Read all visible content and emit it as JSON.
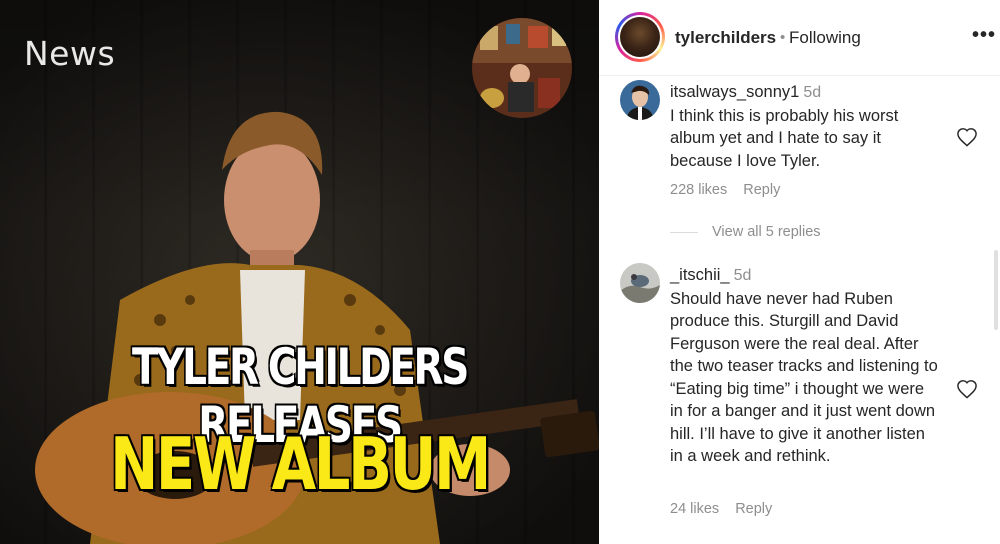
{
  "media": {
    "news_label": "News",
    "headline_line1": "TYLER CHILDERS RELEASES",
    "headline_line2": "NEW ALBUM",
    "headline_color": "#fbe917"
  },
  "post": {
    "username": "tylerchilders",
    "separator": "•",
    "follow_status": "Following",
    "more_icon": "more-dots-icon"
  },
  "comments": [
    {
      "username": "itsalways_sonny1",
      "time": "5d",
      "text": "I think this is probably his worst album yet and I hate to say it because I love Tyler.",
      "likes": "228 likes",
      "reply_label": "Reply",
      "view_replies": "View all 5 replies"
    },
    {
      "username": "_itschii_",
      "time": "5d",
      "text": "Should have never had Ruben produce this. Sturgill and David Ferguson were the real deal. After the two teaser tracks and listening to “Eating big time” i thought we were in for a banger and it just went down hill. I’ll have to give it another listen in a week and rethink.",
      "likes": "24 likes",
      "reply_label": "Reply"
    }
  ]
}
